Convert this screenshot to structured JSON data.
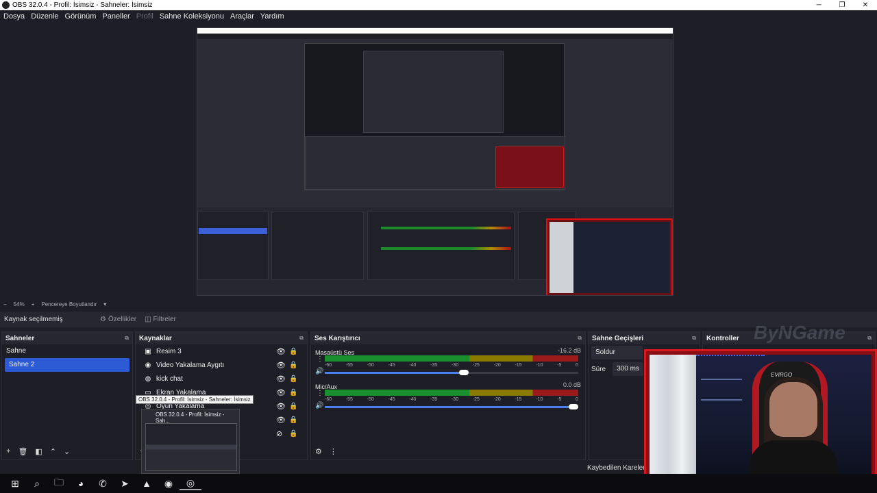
{
  "window": {
    "title": "OBS 32.0.4 - Profil: İsimsiz - Sahneler: İsimsiz",
    "minimize": "─",
    "maximize": "❐",
    "close": "✕"
  },
  "menu": {
    "items": [
      "Dosya",
      "Düzenle",
      "Görünüm",
      "Paneller",
      "Profil",
      "Sahne Koleksiyonu",
      "Araçlar",
      "Yardım"
    ]
  },
  "preview": {
    "zoom_minus": "−",
    "zoom": "54%",
    "zoom_plus": "+",
    "scale_mode": "Pencereye Boyutlandır",
    "dropdown": "▾"
  },
  "context_bar": {
    "no_source": "Kaynak seçilmemiş",
    "properties": "Özellikler",
    "filters": "Filtreler"
  },
  "scenes": {
    "title": "Sahneler",
    "items": [
      "Sahne",
      "Sahne 2"
    ],
    "selected": 1
  },
  "sources": {
    "title": "Kaynaklar",
    "items": [
      {
        "icon": "▣",
        "label": "Resim 3"
      },
      {
        "icon": "◉",
        "label": "Video Yakalama Aygıtı"
      },
      {
        "icon": "◍",
        "label": "kick chat"
      },
      {
        "icon": "▭",
        "label": "Ekran Yakalama"
      },
      {
        "icon": "◎",
        "label": "Oyun Yakalama"
      }
    ]
  },
  "mixer": {
    "title": "Ses Karıştırıcı",
    "channels": [
      {
        "name": "Masaüstü Ses",
        "db": "-16.2 dB",
        "level": 0.57,
        "volume": 0.53
      },
      {
        "name": "Mic/Aux",
        "db": "0.0 dB",
        "level": 0.82,
        "volume": 1.0
      }
    ],
    "ticks": [
      "-60",
      "-55",
      "-50",
      "-45",
      "-40",
      "-35",
      "-30",
      "-25",
      "-20",
      "-15",
      "-10",
      "-5",
      "0"
    ]
  },
  "transitions": {
    "title": "Sahne Geçişleri",
    "type": "Soldur",
    "duration_label": "Süre",
    "duration": "300 ms"
  },
  "controls": {
    "title": "Kontroller"
  },
  "status": {
    "dropped_frames": "Kaybedilen Kareler 3"
  },
  "tooltip": {
    "text": "OBS 32.0.4 - Profil: İsimsiz - Sahneler: İsimsiz"
  },
  "thumbnail": {
    "title": "OBS 32.0.4 - Profil: İsimsiz - Sah..."
  },
  "camera": {
    "chair_brand": "EVIRGO"
  },
  "watermark": "ByNGame",
  "accent": "#2d5bd6"
}
